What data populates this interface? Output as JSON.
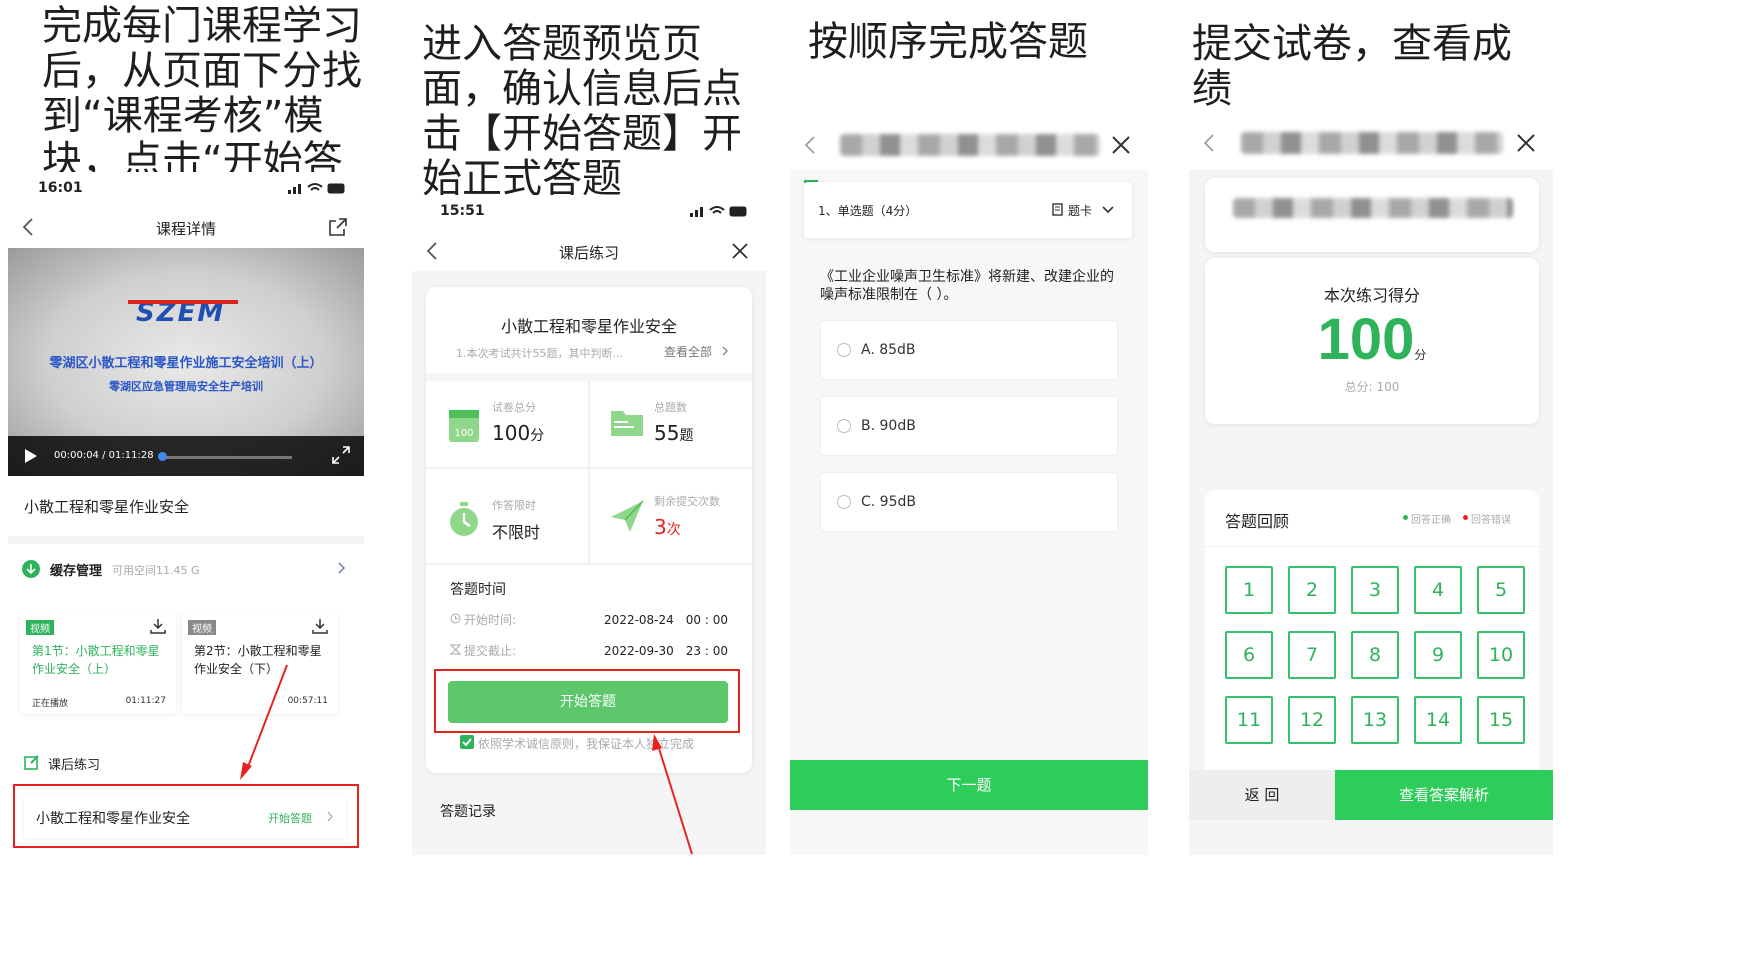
{
  "captions": [
    "完成每门课程学习后，从页面下分找到“课程考核”模块，点击“开始答题”完成考试。",
    "进入答题预览页面，确认信息后点击【开始答题】开始正式答题",
    "按顺序完成答题",
    "提交试卷，查看成绩"
  ],
  "p1": {
    "time": "16:01",
    "title": "课程详情",
    "video_title": "零湖区小散工程和零星作业施工安全培训（上）",
    "video_subtitle": "零湖区应急管理局安全生产培训",
    "logo": "SZEM",
    "video_time": "00:00:04 / 01:11:28",
    "course_name": "小散工程和零星作业安全",
    "cache_label": "缓存管理",
    "cache_space": "可用空间11.45 G",
    "lessons": [
      {
        "tag": "视频",
        "title": "第1节：小散工程和零星作业安全（上）",
        "status": "正在播放",
        "duration": "01:11:27"
      },
      {
        "tag": "视频",
        "title": "第2节：小散工程和零星作业安全（下）",
        "status": "",
        "duration": "00:57:11"
      }
    ],
    "practice_label": "课后练习",
    "exam_name": "小散工程和零星作业安全",
    "start_link": "开始答题"
  },
  "p2": {
    "time": "15:51",
    "title": "课后练习",
    "exam_title": "小散工程和零星作业安全",
    "desc": "1.本次考试共计55题，其中判断...",
    "view_all": "查看全部",
    "stats": [
      {
        "label": "试卷总分",
        "value": "100",
        "unit": "分"
      },
      {
        "label": "总题数",
        "value": "55",
        "unit": "题"
      },
      {
        "label": "作答限时",
        "value": "不限时",
        "unit": ""
      },
      {
        "label": "剩余提交次数",
        "value": "3",
        "unit": "次"
      }
    ],
    "time_section": "答题时间",
    "start_label": "开始时间:",
    "start_value": "2022-08-24　00 : 00",
    "end_label": "提交截止:",
    "end_value": "2022-09-30　23 : 00",
    "start_button": "开始答题",
    "pledge": "依照学术诚信原则，我保证本人独立完成",
    "records": "答题记录"
  },
  "p3": {
    "question_type": "1、单选题（4分）",
    "card_label": "题卡",
    "question": "《工业企业噪声卫生标准》将新建、改建企业的噪声标准限制在（ ）。",
    "options": [
      "A. 85dB",
      "B. 90dB",
      "C. 95dB"
    ],
    "next_button": "下一题"
  },
  "p4": {
    "score_label": "本次练习得分",
    "score": "100",
    "score_unit": "分",
    "total": "总分: 100",
    "review_title": "答题回顾",
    "legend_correct": "回答正确",
    "legend_wrong": "回答错误",
    "numbers": [
      "1",
      "2",
      "3",
      "4",
      "5",
      "6",
      "7",
      "8",
      "9",
      "10",
      "11",
      "12",
      "13",
      "14",
      "15"
    ],
    "back_button": "返 回",
    "analysis_button": "查看答案解析"
  },
  "colors": {
    "green": "#2fb35a",
    "button_green": "#5cc86b",
    "red": "#e6231f"
  }
}
